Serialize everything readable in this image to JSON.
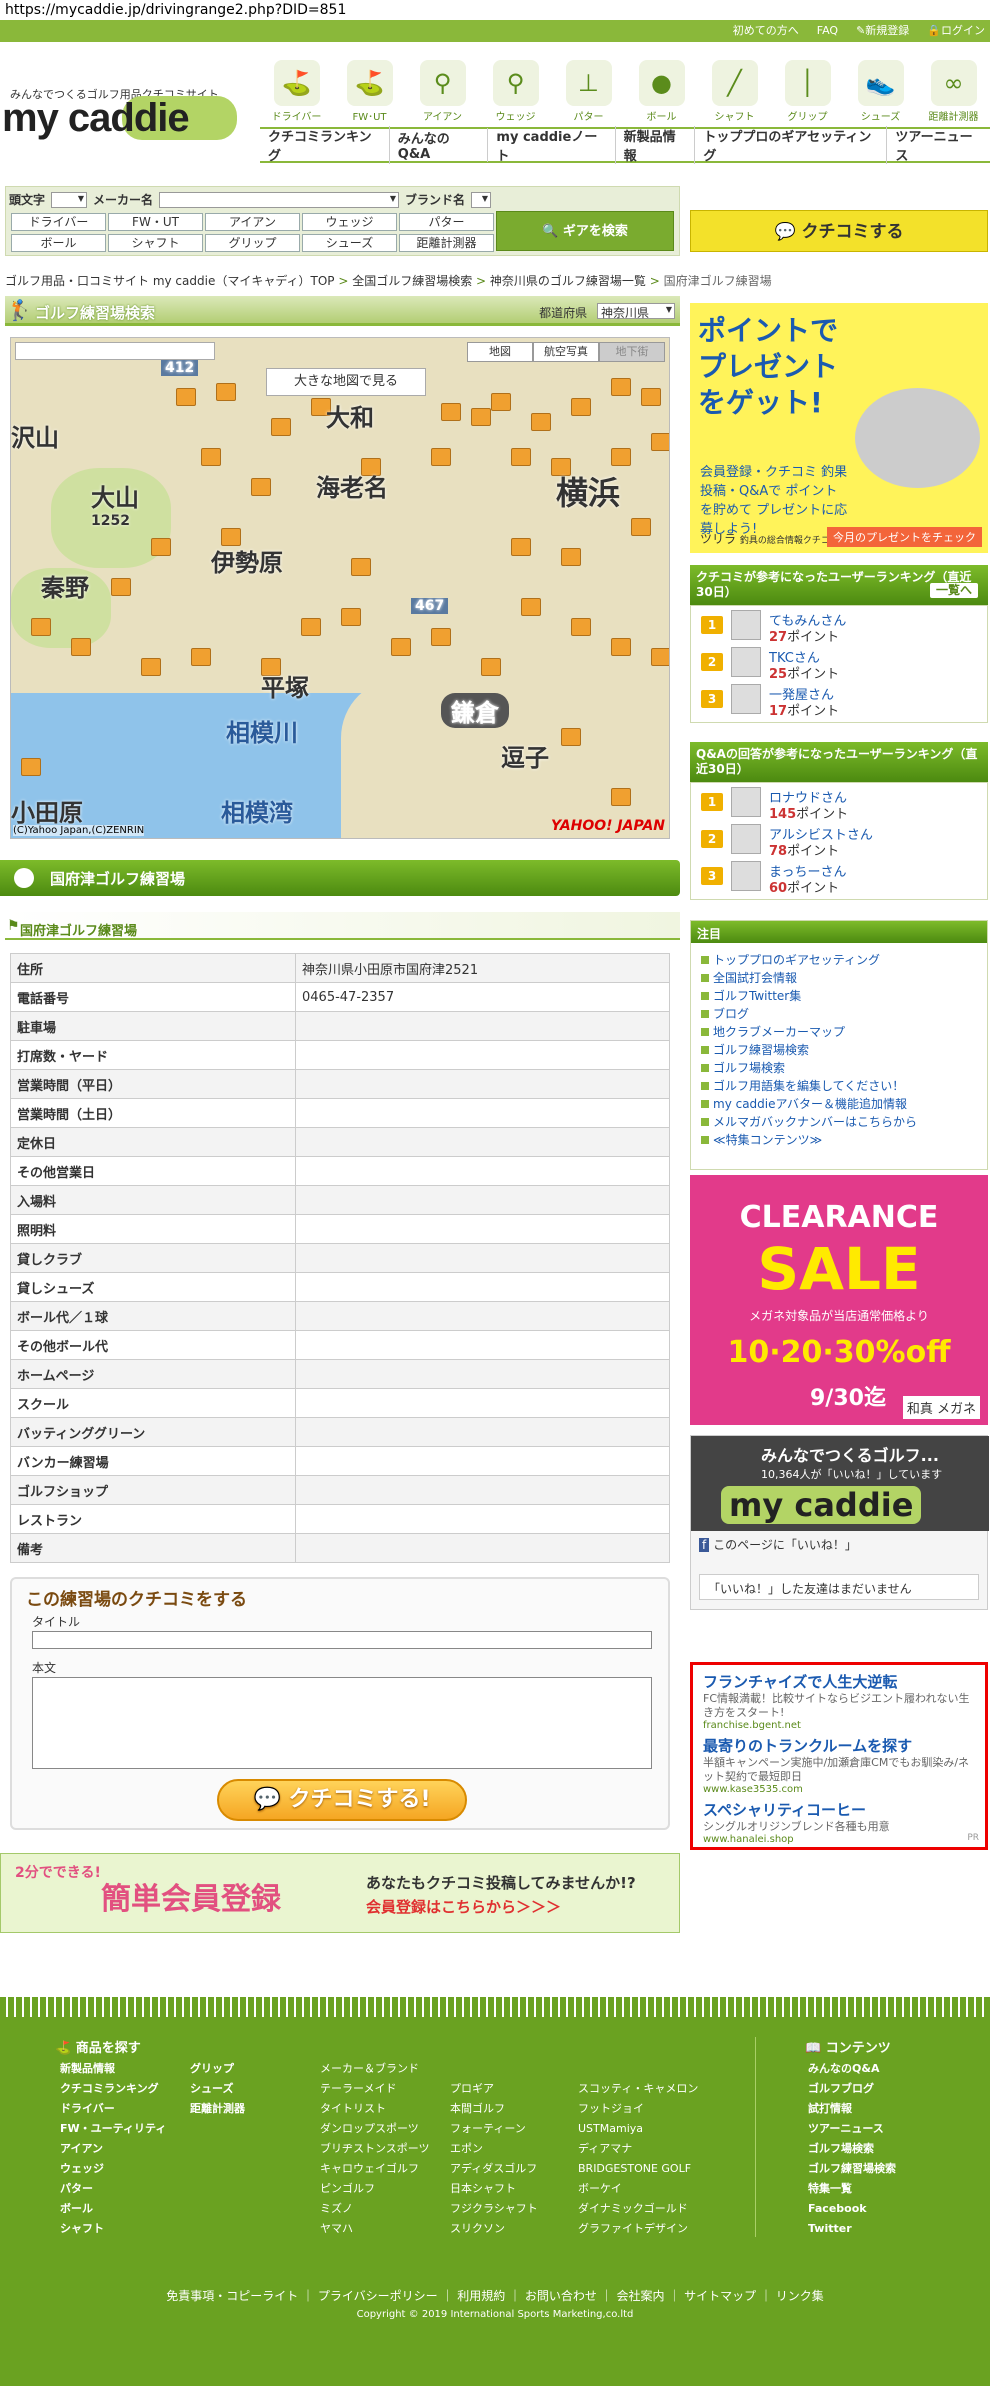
{
  "url": "https://mycaddie.jp/drivingrange2.php?DID=851",
  "topbar": {
    "beginners": "初めての方へ",
    "faq": "FAQ",
    "register": "新規登録",
    "login": "ログイン"
  },
  "logo": {
    "tagline": "みんなでつくるゴルフ用品クチコミサイト",
    "name": "my caddie"
  },
  "categories": [
    "ドライバー",
    "FW･UT",
    "アイアン",
    "ウェッジ",
    "パター",
    "ボール",
    "シャフト",
    "グリップ",
    "シューズ",
    "距離計測器"
  ],
  "subnav": [
    "クチコミランキング",
    "みんなのQ&A",
    "my caddieノート",
    "新製品情報",
    "トッププロのギアセッティング",
    "ツアーニュース"
  ],
  "search": {
    "initial_label": "頭文字",
    "maker_label": "メーカー名",
    "brand_label": "ブランド名",
    "tags": [
      "ドライバー",
      "FW・UT",
      "アイアン",
      "ウェッジ",
      "パター",
      "ボール",
      "シャフト",
      "グリップ",
      "シューズ",
      "距離計測器"
    ],
    "gear_button": "ギアを検索"
  },
  "kuchikomi_button": "クチコミする",
  "breadcrumb": [
    "ゴルフ用品・口コミサイト my caddie（マイキャディ）TOP",
    "全国ゴルフ練習場検索",
    "神奈川県のゴルフ練習場一覧",
    "国府津ゴルフ練習場"
  ],
  "range_search": {
    "title": "ゴルフ練習場検索",
    "pref_label": "都道府県",
    "pref_value": "神奈川県"
  },
  "map": {
    "tabs": [
      "地図",
      "航空写真",
      "地下街"
    ],
    "big_map": "大きな地図で見る",
    "labels": [
      "大和",
      "海老名",
      "横浜",
      "大山",
      "1252",
      "伊勢原",
      "秦野",
      "平塚",
      "相模川",
      "鎌倉",
      "逗子",
      "相模湾",
      "小田原",
      "沢山",
      "412",
      "467"
    ],
    "copyright": "(C)Yahoo Japan,(C)ZENRIN",
    "logo": "YAHOO! JAPAN"
  },
  "facility": {
    "bar_title": "国府津ゴルフ練習場",
    "sub_title": "国府津ゴルフ練習場",
    "rows": [
      {
        "k": "住所",
        "v": "神奈川県小田原市国府津2521"
      },
      {
        "k": "電話番号",
        "v": "0465-47-2357"
      },
      {
        "k": "駐車場",
        "v": ""
      },
      {
        "k": "打席数・ヤード",
        "v": ""
      },
      {
        "k": "営業時間（平日）",
        "v": ""
      },
      {
        "k": "営業時間（土日）",
        "v": ""
      },
      {
        "k": "定休日",
        "v": ""
      },
      {
        "k": "その他営業日",
        "v": ""
      },
      {
        "k": "入場料",
        "v": ""
      },
      {
        "k": "照明料",
        "v": ""
      },
      {
        "k": "貸しクラブ",
        "v": ""
      },
      {
        "k": "貸しシューズ",
        "v": ""
      },
      {
        "k": "ボール代／１球",
        "v": ""
      },
      {
        "k": "その他ボール代",
        "v": ""
      },
      {
        "k": "ホームページ",
        "v": ""
      },
      {
        "k": "スクール",
        "v": ""
      },
      {
        "k": "バッティンググリーン",
        "v": ""
      },
      {
        "k": "バンカー練習場",
        "v": ""
      },
      {
        "k": "ゴルフショップ",
        "v": ""
      },
      {
        "k": "レストラン",
        "v": ""
      },
      {
        "k": "備考",
        "v": ""
      }
    ]
  },
  "review": {
    "title": "この練習場のクチコミをする",
    "title_label": "タイトル",
    "body_label": "本文",
    "submit": "クチコミする!"
  },
  "register_banner": {
    "badge": "2分でできる!",
    "title": "簡単会員登録",
    "line1": "あなたもクチコミ投稿してみませんか!?",
    "line2": "会員登録はこちらから＞＞＞"
  },
  "sidebar": {
    "point_ad": {
      "title": "ポイントでプレゼントをゲット!",
      "text": "会員登録・クチコミ 釣果投稿・Q&Aで ポイントを貯めて プレゼントに応募しよう!",
      "brand": "ツリラ",
      "brand_sub": "釣具の総合情報クチコミサイト",
      "cta": "今月のプレゼントをチェック"
    },
    "rank1": {
      "title": "クチコミが参考になったユーザーランキング（直近30日）",
      "more": "一覧へ",
      "rows": [
        {
          "n": "1",
          "name": "てもみんさん",
          "pt": "27",
          "unit": "ポイント"
        },
        {
          "n": "2",
          "name": "TKCさん",
          "pt": "25",
          "unit": "ポイント"
        },
        {
          "n": "3",
          "name": "一発屋さん",
          "pt": "17",
          "unit": "ポイント"
        }
      ]
    },
    "rank2": {
      "title": "Q&Aの回答が参考になったユーザーランキング（直近30日）",
      "rows": [
        {
          "n": "1",
          "name": "ロナウドさん",
          "pt": "145",
          "unit": "ポイント"
        },
        {
          "n": "2",
          "name": "アルシビストさん",
          "pt": "78",
          "unit": "ポイント"
        },
        {
          "n": "3",
          "name": "まっちーさん",
          "pt": "60",
          "unit": "ポイント"
        }
      ]
    },
    "notice": {
      "title": "注目",
      "items": [
        "トッププロのギアセッティング",
        "全国試打会情報",
        "ゴルフTwitter集",
        "ブログ",
        "地クラブメーカーマップ",
        "ゴルフ練習場検索",
        "ゴルフ場検索",
        "ゴルフ用語集を編集してください！",
        "my caddieアバター＆機能追加情報",
        "メルマガバックナンバーはこちらから",
        "≪特集コンテンツ≫"
      ]
    },
    "clearance": {
      "title": "CLEARANCE",
      "sale": "SALE",
      "sub": "メガネ対象品が当店通常価格より",
      "pct": "10·20·30%off",
      "date": "9/30迄",
      "brand": "和真 メガネ"
    },
    "fb": {
      "title": "みんなでつくるゴルフ...",
      "sub": "10,364人が「いいね！」しています",
      "logo": "my caddie",
      "like": "このページに「いいね！」",
      "msg": "「いいね！」した友達はまだいません"
    },
    "ads": [
      {
        "h": "フランチャイズで人生大逆転",
        "d": "FC情報満載！比較サイトならビジエント履われない生き方をスタート!",
        "u": "franchise.bgent.net"
      },
      {
        "h": "最寄りのトランクルームを探す",
        "d": "半額キャンペーン実施中/加瀬倉庫CMでもお馴染み/ネット契約で最短即日",
        "u": "www.kase3535.com"
      },
      {
        "h": "スペシャリティコーヒー",
        "d": "シングルオリジンブレンド各種も用意",
        "u": "www.hanalei.shop"
      }
    ],
    "pr": "PR"
  },
  "footer": {
    "products_head": "商品を探す",
    "contents_head": "コンテンツ",
    "col1": [
      "新製品情報",
      "クチコミランキング",
      "ドライバー",
      "FW・ユーティリティ",
      "アイアン",
      "ウェッジ",
      "パター",
      "ボール",
      "シャフト"
    ],
    "col2": [
      "グリップ",
      "シューズ",
      "距離計測器"
    ],
    "col3": [
      "メーカー＆ブランド",
      "テーラーメイド",
      "タイトリスト",
      "ダンロップスポーツ",
      "ブリヂストンスポーツ",
      "キャロウェイゴルフ",
      "ピンゴルフ",
      "ミズノ",
      "ヤマハ"
    ],
    "col4": [
      "プロギア",
      "本間ゴルフ",
      "フォーティーン",
      "エポン",
      "アディダスゴルフ",
      "日本シャフト",
      "フジクラシャフト",
      "スリクソン"
    ],
    "col5": [
      "スコッティ・キャメロン",
      "フットジョイ",
      "USTMamiya",
      "ディアマナ",
      "BRIDGESTONE GOLF",
      "ボーケイ",
      "ダイナミックゴールド",
      "グラファイトデザイン"
    ],
    "col6": [
      "みんなのQ&A",
      "ゴルフブログ",
      "試打情報",
      "ツアーニュース",
      "ゴルフ場検索",
      "ゴルフ練習場検索",
      "特集一覧",
      "Facebook",
      "Twitter"
    ],
    "bottom_links": "免責事項・コピーライト ｜ プライバシーポリシー ｜ 利用規約 ｜ お問い合わせ ｜ 会社案内 ｜ サイトマップ ｜ リンク集",
    "copyright": "Copyright © 2019 International Sports Marketing,co.ltd"
  }
}
